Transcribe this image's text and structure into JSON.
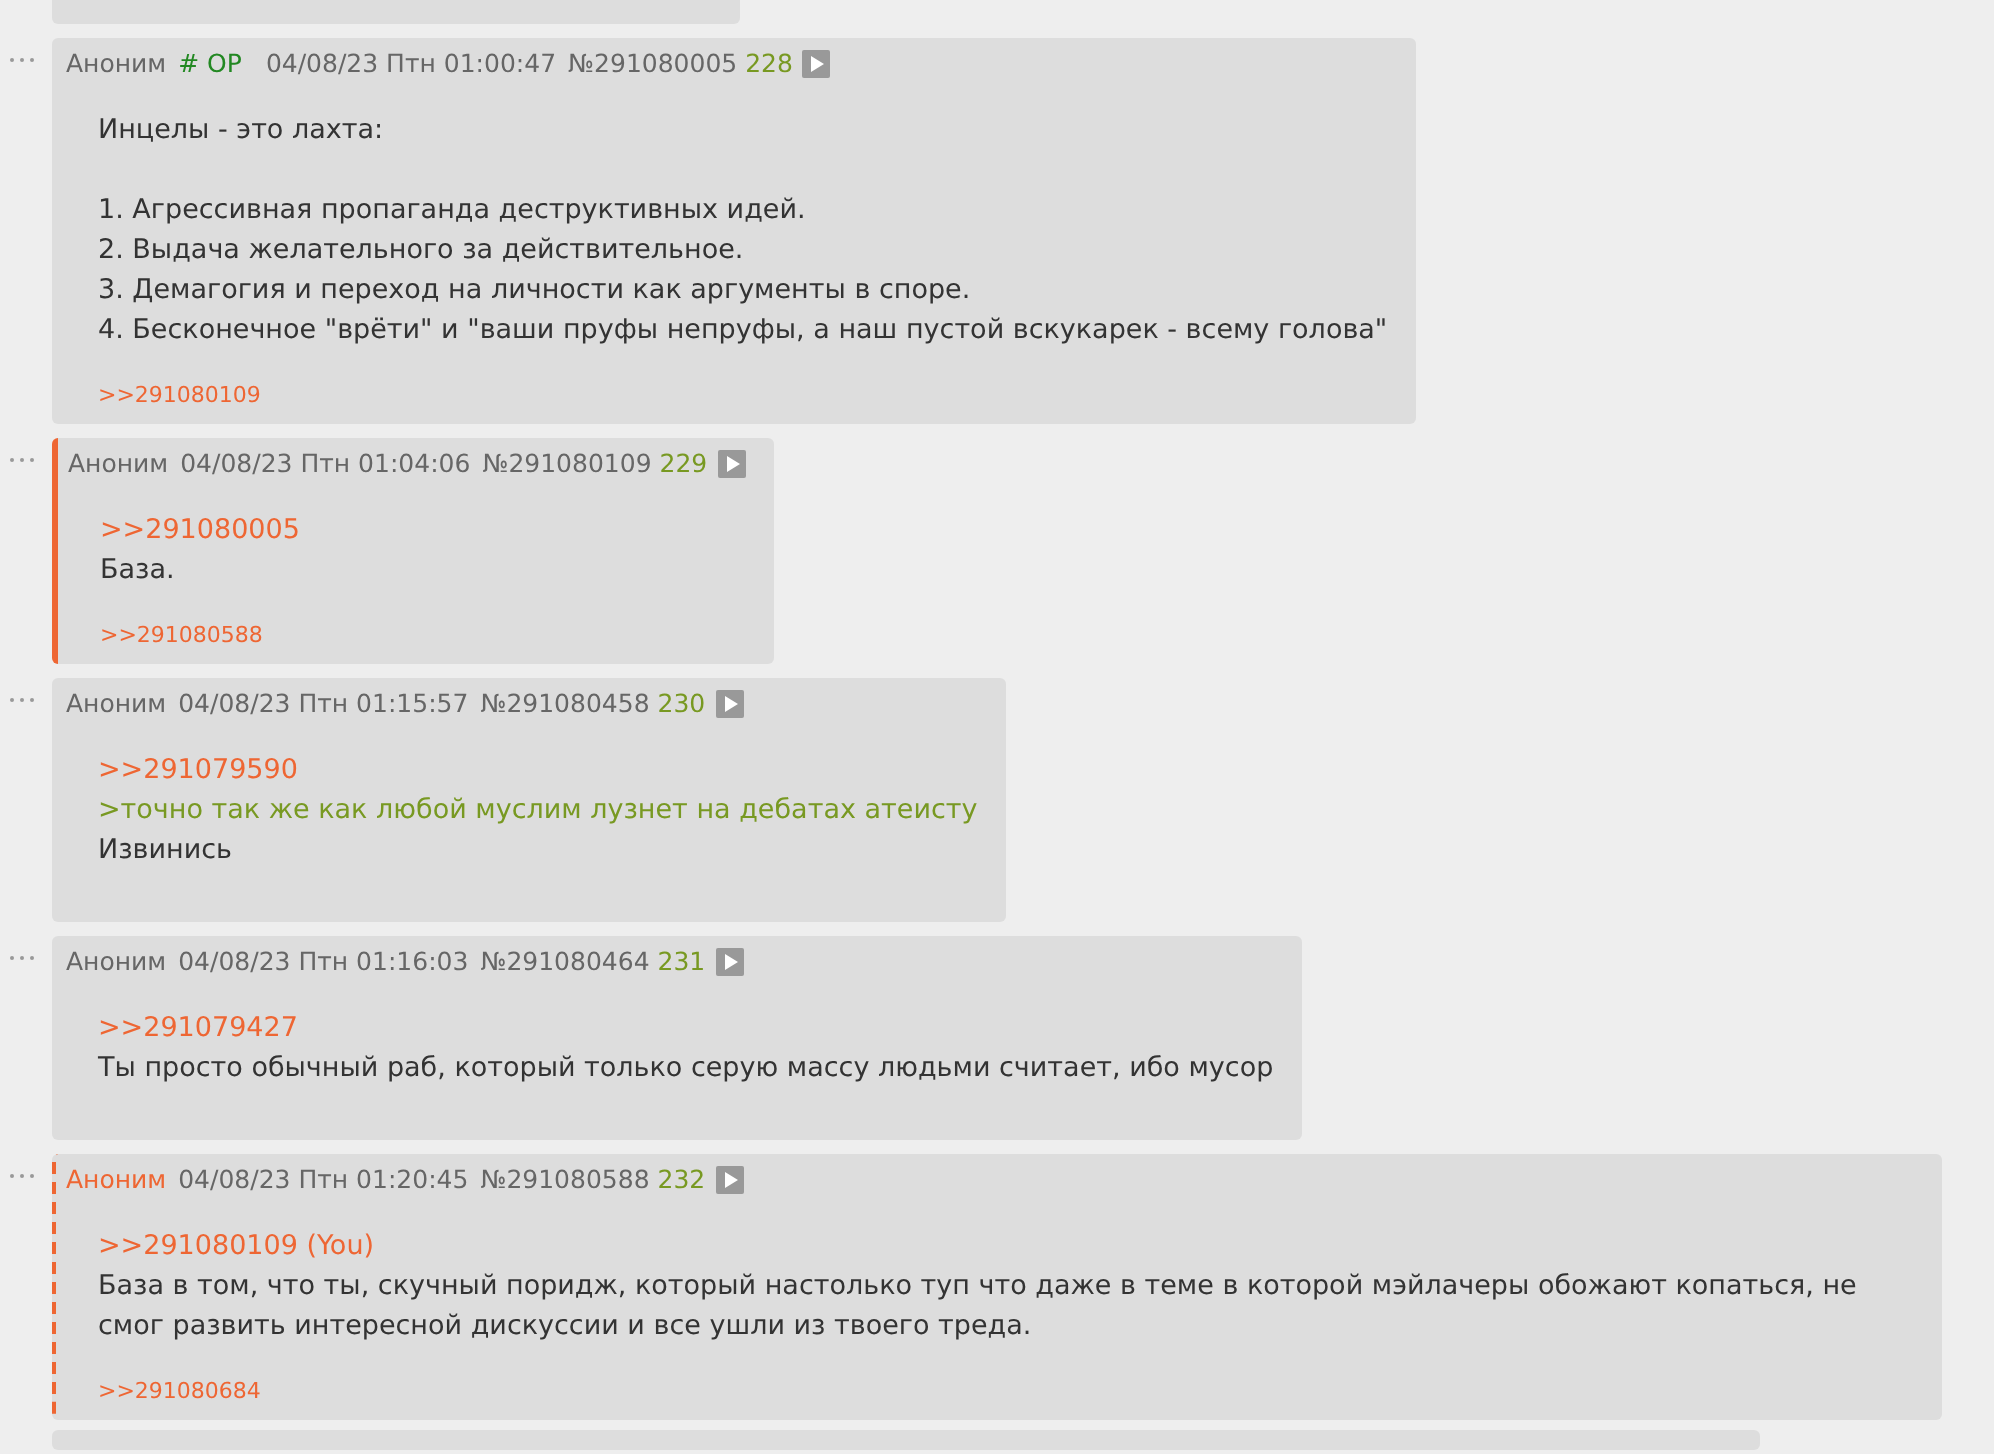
{
  "posts": [
    {
      "name": "Аноним",
      "op": true,
      "op_label": "# OP",
      "date": "04/08/23 Птн 01:00:47",
      "number": "№291080005",
      "count": "228",
      "highlighted": false,
      "mine": false,
      "body": [
        {
          "kind": "text",
          "text": "Инцелы - это лахта:\n\n1. Агрессивная пропаганда деструктивных идей.\n2. Выдача желательного за действительное.\n3. Демагогия и переход на личности как аргументы в споре.\n4. Бесконечное \"врёти\" и \"ваши пруфы непруфы, а наш пустой вскукарек - всему голова\""
        }
      ],
      "replies": [
        ">>291080109"
      ]
    },
    {
      "name": "Аноним",
      "op": false,
      "date": "04/08/23 Птн 01:04:06",
      "number": "№291080109",
      "count": "229",
      "highlighted": true,
      "mine": false,
      "body": [
        {
          "kind": "reply_link",
          "text": ">>291080005"
        },
        {
          "kind": "text",
          "text": "База."
        }
      ],
      "replies": [
        ">>291080588"
      ]
    },
    {
      "name": "Аноним",
      "op": false,
      "date": "04/08/23 Птн 01:15:57",
      "number": "№291080458",
      "count": "230",
      "highlighted": false,
      "mine": false,
      "body": [
        {
          "kind": "reply_link",
          "text": ">>291079590"
        },
        {
          "kind": "quote",
          "text": ">точно так же как любой муслим лузнет на дебатах атеисту"
        },
        {
          "kind": "text",
          "text": "Извинись"
        }
      ]
    },
    {
      "name": "Аноним",
      "op": false,
      "date": "04/08/23 Птн 01:16:03",
      "number": "№291080464",
      "count": "231",
      "highlighted": false,
      "mine": false,
      "body": [
        {
          "kind": "reply_link",
          "text": ">>291079427"
        },
        {
          "kind": "text",
          "text": "Ты просто обычный раб, который только серую массу людьми считает, ибо мусор"
        }
      ]
    },
    {
      "name": "Аноним",
      "op": false,
      "date": "04/08/23 Птн 01:20:45",
      "number": "№291080588",
      "count": "232",
      "highlighted": false,
      "mine": true,
      "body": [
        {
          "kind": "reply_link",
          "text": ">>291080109 (You)"
        },
        {
          "kind": "text",
          "text": "База в том, что ты, скучный поридж, который настолько туп что даже в теме в которой мэйлачеры обожают копаться, не смог развить интересной дискуссии и все ушли из твоего треда."
        }
      ],
      "replies": [
        ">>291080684"
      ]
    }
  ]
}
